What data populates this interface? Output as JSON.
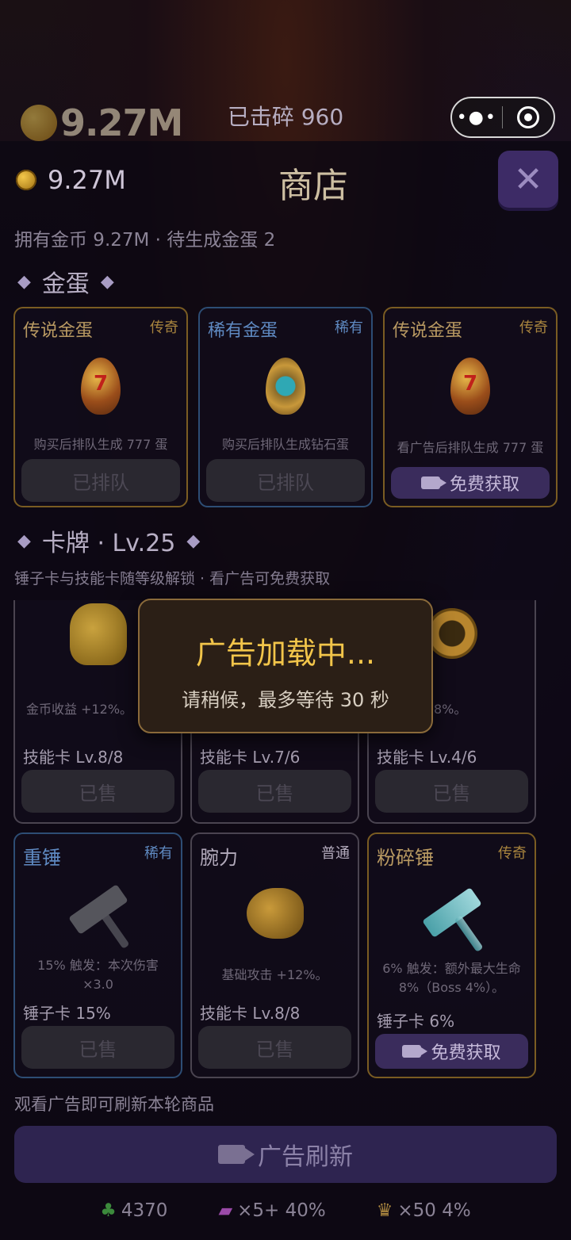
{
  "hud": {
    "coins": "9.27M",
    "smashed": "已击碎 960",
    "menu_icon": "more-dots-icon",
    "close_icon": "target-close-icon"
  },
  "shop": {
    "coins": "9.27M",
    "title": "商店",
    "close_glyph": "✕",
    "summary": "拥有金币 9.27M · 待生成金蛋 2",
    "egg_section": "金蛋",
    "card_section": "卡牌 · Lv.25",
    "card_note": "锤子卡与技能卡随等级解锁 · 看广告可免费获取",
    "diamond": "◆"
  },
  "eggs": [
    {
      "name": "传说金蛋",
      "tier": "传奇",
      "desc": "购买后排队生成 777 蛋",
      "button": "已排队"
    },
    {
      "name": "稀有金蛋",
      "tier": "稀有",
      "desc": "购买后排队生成钻石蛋",
      "button": "已排队"
    },
    {
      "name": "传说金蛋",
      "tier": "传奇",
      "desc": "看广告后排队生成 777 蛋",
      "button": "免费获取"
    }
  ],
  "cards_row1": [
    {
      "desc": "金币收益 +12%。",
      "stat": "技能卡 Lv.8/8",
      "button": "已售"
    },
    {
      "desc": "",
      "stat": "技能卡 Lv.7/6",
      "button": "已售"
    },
    {
      "desc": "8%。",
      "stat": "技能卡 Lv.4/6",
      "button": "已售"
    }
  ],
  "cards_row2": [
    {
      "name": "重锤",
      "tier": "稀有",
      "desc": "15% 触发：本次伤害 ×3.0",
      "stat": "锤子卡 15%",
      "button": "已售"
    },
    {
      "name": "腕力",
      "tier": "普通",
      "desc": "基础攻击 +12%。",
      "stat": "技能卡 Lv.8/8",
      "button": "已售"
    },
    {
      "name": "粉碎锤",
      "tier": "传奇",
      "desc": "6% 触发：额外最大生命 8%（Boss 4%）。",
      "stat": "锤子卡 6%",
      "button": "免费获取"
    }
  ],
  "refresh": {
    "note": "观看广告即可刷新本轮商品",
    "button": "广告刷新"
  },
  "footer": {
    "clover": "4370",
    "ticket": "×5+ 40%",
    "trophy": "×50 4%"
  },
  "toast": {
    "title": "广告加载中...",
    "message": "请稍候，最多等待 30 秒"
  }
}
